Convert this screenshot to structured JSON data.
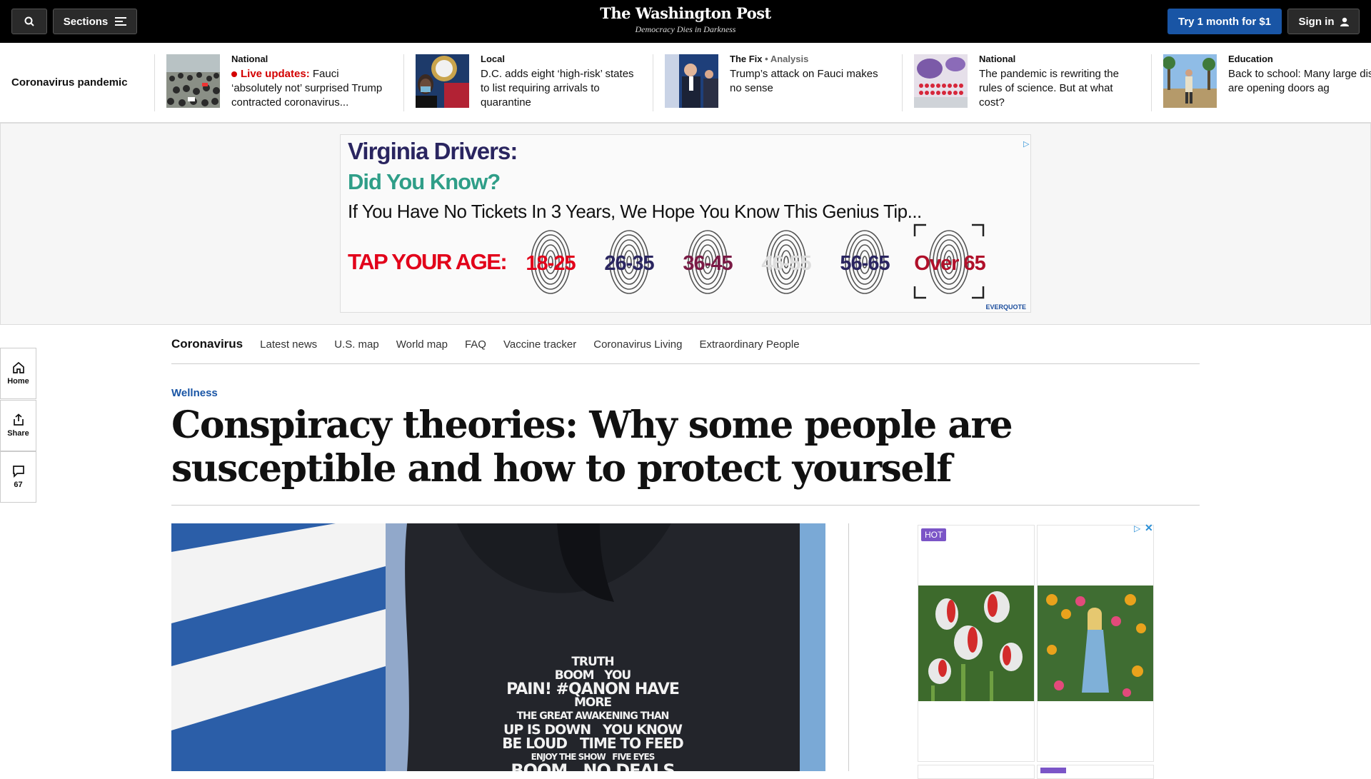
{
  "header": {
    "sections_label": "Sections",
    "logo_text": "The Washington Post",
    "tagline": "Democracy Dies in Darkness",
    "try_label": "Try 1 month for $1",
    "signin_label": "Sign in"
  },
  "rail": {
    "title": "Coronavirus pandemic",
    "items": [
      {
        "kicker": "National",
        "live_label": "Live updates:",
        "text": "Fauci ‘absolutely not’ surprised Trump contracted coronavirus..."
      },
      {
        "kicker": "Local",
        "text": "D.C. adds eight ‘high-risk’ states to list requiring arrivals to quarantine"
      },
      {
        "kicker": "The Fix",
        "kicker_extra": "• Analysis",
        "text": "Trump’s attack on Fauci makes no sense"
      },
      {
        "kicker": "National",
        "text": "The pandemic is rewriting the rules of science. But at what cost?"
      },
      {
        "kicker": "Education",
        "text": "Back to school: Many large districts are opening doors ag"
      }
    ]
  },
  "ad_banner": {
    "line1": "Virginia Drivers:",
    "line2": "Did You Know?",
    "line3": "If You Have No Tickets In 3 Years, We Hope You Know This Genius Tip...",
    "tap": "TAP YOUR AGE:",
    "ages": [
      {
        "label": "18-25",
        "color": "#e2001a"
      },
      {
        "label": "26-35",
        "color": "#2a2560"
      },
      {
        "label": "36-45",
        "color": "#7a1a45"
      },
      {
        "label": "46-55",
        "color": "#dddddd"
      },
      {
        "label": "56-65",
        "color": "#2a2560"
      },
      {
        "label": "Over 65",
        "color": "#b0102a"
      }
    ],
    "brand": "EVERQUOTE"
  },
  "side_rail": {
    "home_label": "Home",
    "share_label": "Share",
    "comments_count": "67"
  },
  "subnav": {
    "brand": "Coronavirus",
    "links": [
      "Latest news",
      "U.S. map",
      "World map",
      "FAQ",
      "Vaccine tracker",
      "Coronavirus Living",
      "Extraordinary People"
    ]
  },
  "article": {
    "section": "Wellness",
    "headline": "Conspiracy theories: Why some people are susceptible and how to protect yourself",
    "hoodie_lines": [
      "TRUTH",
      "BOOM",
      "YOU",
      "PAIN! #QANON",
      "HAVE",
      "MORE",
      "THE GREAT AWAKENING THAN",
      "UP IS DOWN",
      "YOU KNOW",
      "BE LOUD",
      "TIME TO FEED",
      "ENJOY THE SHOW",
      "FIVE EYES",
      "BOOM",
      "NO DEALS"
    ]
  },
  "side_ad": {
    "badge": "HOT"
  }
}
